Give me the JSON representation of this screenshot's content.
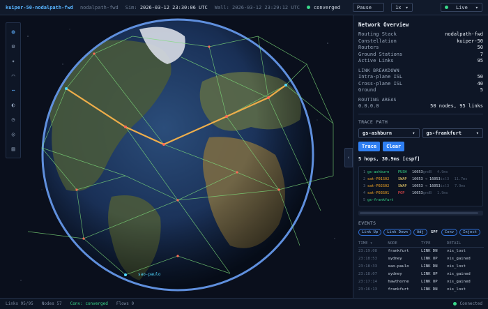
{
  "topbar": {
    "title": "kuiper-50-nodalpath-fwd",
    "subtitle": "nodalpath-fwd",
    "sim_label": "Sim:",
    "sim_time": "2026-03-12 23:30:06 UTC",
    "wall_label": "Wall:",
    "wall_time": "2026-03-12 23:29:12 UTC",
    "status": "converged",
    "pause_label": "Pause",
    "speed": "1x",
    "live_label": "Live",
    "status_color": "#39d98a"
  },
  "toolbar": {
    "icons": [
      "globe-icon",
      "settings-icon",
      "satellite-icon",
      "ground-station-icon",
      "links-icon",
      "color-icon",
      "clock-icon",
      "target-icon",
      "layers-icon"
    ],
    "glyphs": [
      "◍",
      "⚙",
      "✦",
      "⌒",
      "⋯",
      "◐",
      "◷",
      "◎",
      "▤"
    ]
  },
  "globe": {
    "ground_station_label": "sao-paulo"
  },
  "overview": {
    "title": "Network Overview",
    "rows": [
      {
        "k": "Routing Stack",
        "v": "nodalpath-fwd"
      },
      {
        "k": "Constellation",
        "v": "kuiper-50"
      },
      {
        "k": "Routers",
        "v": "50"
      },
      {
        "k": "Ground Stations",
        "v": "7"
      },
      {
        "k": "Active Links",
        "v": "95"
      }
    ],
    "link_breakdown_label": "LINK BREAKDOWN",
    "links": [
      {
        "k": "Intra-plane ISL",
        "v": "50"
      },
      {
        "k": "Cross-plane ISL",
        "v": "40"
      },
      {
        "k": "Ground",
        "v": "5"
      }
    ],
    "routing_areas_label": "ROUTING AREAS",
    "area": {
      "k": "0.0.0.0",
      "v": "50 nodes, 95 links"
    }
  },
  "trace": {
    "label": "TRACE PATH",
    "source": "gs-ashburn",
    "destination": "gs-frankfurt",
    "trace_button": "Trace",
    "clear_button": "Clear",
    "summary": "5 hops, 30.9ms [cspf]",
    "hops": [
      {
        "idx": "1",
        "node": "gs-ashburn",
        "action": "PUSH",
        "label": "16053",
        "ifc": "gndB",
        "lat": "4.9ms",
        "node_color": "#39d98a",
        "action_color": "#39d98a"
      },
      {
        "idx": "2",
        "node": "sat-P01S02",
        "action": "SWAP",
        "label": "16053 → 16053",
        "ifc": "isl3",
        "lat": "11.7ms",
        "node_color": "#f5a623",
        "action_color": "#f5d76e"
      },
      {
        "idx": "3",
        "node": "sat-P02S02",
        "action": "SWAP",
        "label": "16053 → 16053",
        "ifc": "isl3",
        "lat": "7.9ms",
        "node_color": "#f5a623",
        "action_color": "#f5d76e"
      },
      {
        "idx": "4",
        "node": "sat-P03S01",
        "action": "POP",
        "label": "16053",
        "ifc": "gndB",
        "lat": "1.9ms",
        "node_color": "#f5a623",
        "action_color": "#ff4d4f"
      },
      {
        "idx": "5",
        "node": "gs-frankfurt",
        "action": "",
        "label": "",
        "ifc": "",
        "lat": "",
        "node_color": "#39d98a",
        "action_color": "#39d98a"
      }
    ]
  },
  "events": {
    "label": "EVENTS",
    "filters": [
      "Link Up",
      "Link Down",
      "Adj"
    ],
    "filter_plain": "SPF",
    "filters_right": [
      "Conv",
      "Inject"
    ],
    "columns": [
      "TIME ▾",
      "NODE",
      "TYPE",
      "DETAIL"
    ],
    "rows": [
      {
        "time": "23:19:08",
        "node": "frankfurt",
        "type": "LINK DN",
        "detail": "vis_lost",
        "kind": "down"
      },
      {
        "time": "23:18:53",
        "node": "sydney",
        "type": "LINK UP",
        "detail": "vis_gained",
        "kind": "up"
      },
      {
        "time": "23:18:33",
        "node": "sao-paulo",
        "type": "LINK DN",
        "detail": "vis_lost",
        "kind": "down"
      },
      {
        "time": "23:18:07",
        "node": "sydney",
        "type": "LINK UP",
        "detail": "vis_gained",
        "kind": "up"
      },
      {
        "time": "23:17:14",
        "node": "hawthorne",
        "type": "LINK UP",
        "detail": "vis_gained",
        "kind": "up"
      },
      {
        "time": "23:16:13",
        "node": "frankfurt",
        "type": "LINK DN",
        "detail": "vis_lost",
        "kind": "down"
      }
    ]
  },
  "statusbar": {
    "links": "Links 95/95",
    "nodes": "Nodes 57",
    "conv": "Conv: converged",
    "flows": "Flows 0",
    "connected": "Connected"
  }
}
